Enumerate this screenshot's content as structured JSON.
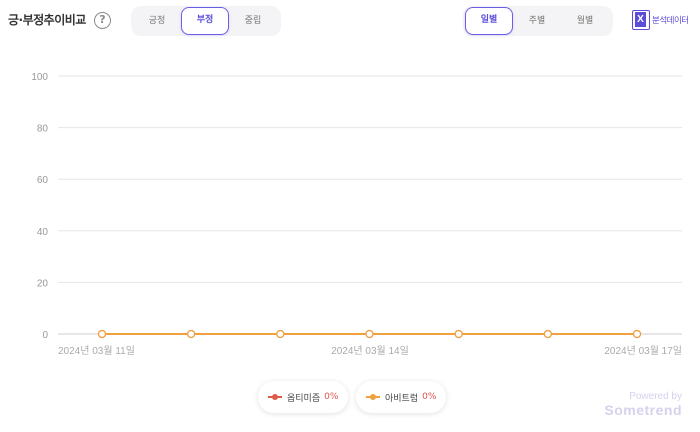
{
  "header": {
    "title": "긍·부정추이비교",
    "help_icon": "?"
  },
  "sentiment_tabs": [
    {
      "label": "긍정",
      "active": false
    },
    {
      "label": "부정",
      "active": true
    },
    {
      "label": "중립",
      "active": false
    }
  ],
  "period_tabs": [
    {
      "label": "일별",
      "active": true
    },
    {
      "label": "주별",
      "active": false
    },
    {
      "label": "월별",
      "active": false
    }
  ],
  "export": {
    "icon": "excel-icon",
    "icon_letter": "X",
    "label": "분석데이터"
  },
  "legend": [
    {
      "name": "옵티미즘",
      "pct": "0%",
      "color": "#e05a4a"
    },
    {
      "name": "아비트럼",
      "pct": "0%",
      "color": "#f0a03c"
    }
  ],
  "powered": {
    "by": "Powered by",
    "brand": "Sometrend"
  },
  "chart_data": {
    "type": "line",
    "ylim": [
      0,
      100
    ],
    "y_ticks": [
      0,
      20,
      40,
      60,
      80,
      100
    ],
    "x_tick_labels": [
      "2024년 03월 11일",
      "2024년 03월 14일",
      "2024년 03월 17일"
    ],
    "x": [
      "2024-03-11",
      "2024-03-12",
      "2024-03-13",
      "2024-03-14",
      "2024-03-15",
      "2024-03-16",
      "2024-03-17"
    ],
    "series": [
      {
        "name": "옵티미즘",
        "color": "#e05a4a",
        "values": [
          0,
          0,
          0,
          0,
          0,
          0,
          0
        ]
      },
      {
        "name": "아비트럼",
        "color": "#f0a03c",
        "values": [
          0,
          0,
          0,
          0,
          0,
          0,
          0
        ]
      }
    ],
    "grid": true
  }
}
